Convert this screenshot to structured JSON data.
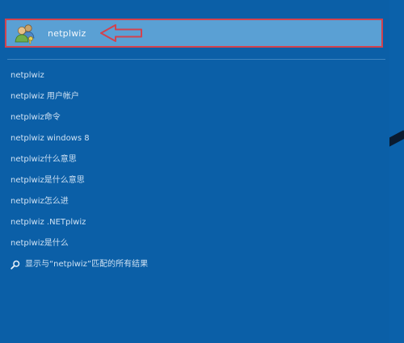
{
  "best_match": {
    "label": "netplwiz",
    "icon": "users-icon"
  },
  "suggestions": [
    "netplwiz",
    "netplwiz 用户帐户",
    "netplwiz命令",
    "netplwiz windows 8",
    "netplwiz什么意思",
    "netplwiz是什么意思",
    "netplwiz怎么进",
    "netplwiz .NETplwiz",
    "netplwiz是什么"
  ],
  "web_search": {
    "icon": "search-icon",
    "label": "显示与“netplwiz”匹配的所有结果"
  },
  "colors": {
    "panel": "#0b5fa7",
    "highlight": "#5aa0d4",
    "annotation": "#d2424e"
  }
}
